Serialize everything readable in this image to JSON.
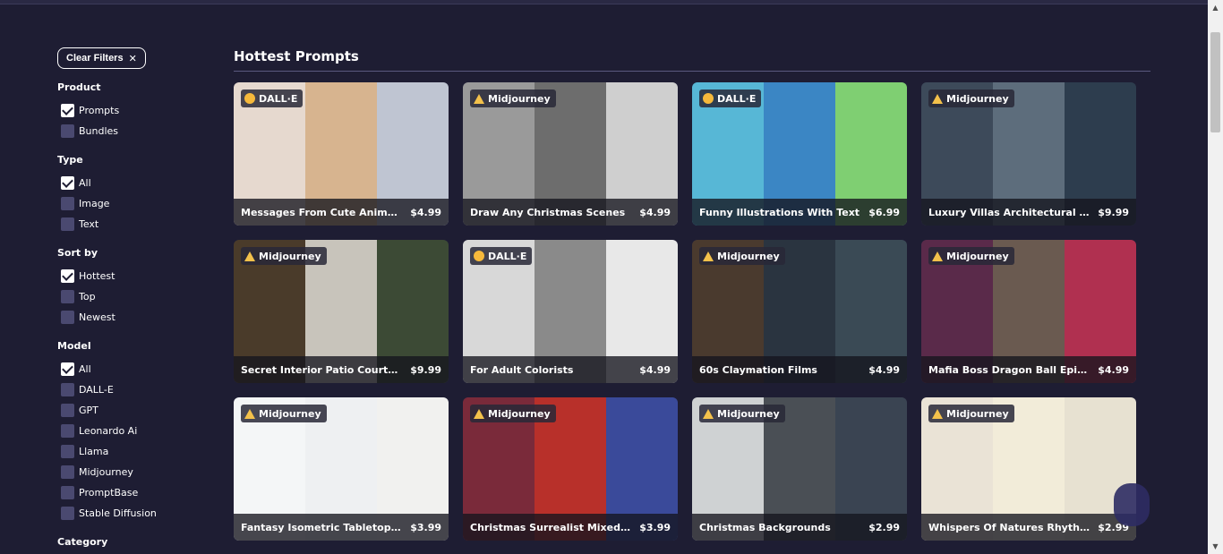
{
  "sidebar": {
    "clear_label": "Clear Filters",
    "groups": [
      {
        "title": "Product",
        "options": [
          {
            "label": "Prompts",
            "checked": true
          },
          {
            "label": "Bundles",
            "checked": false
          }
        ]
      },
      {
        "title": "Type",
        "options": [
          {
            "label": "All",
            "checked": true
          },
          {
            "label": "Image",
            "checked": false
          },
          {
            "label": "Text",
            "checked": false
          }
        ]
      },
      {
        "title": "Sort by",
        "options": [
          {
            "label": "Hottest",
            "checked": true
          },
          {
            "label": "Top",
            "checked": false
          },
          {
            "label": "Newest",
            "checked": false
          }
        ]
      },
      {
        "title": "Model",
        "options": [
          {
            "label": "All",
            "checked": true
          },
          {
            "label": "DALL-E",
            "checked": false
          },
          {
            "label": "GPT",
            "checked": false
          },
          {
            "label": "Leonardo Ai",
            "checked": false
          },
          {
            "label": "Llama",
            "checked": false
          },
          {
            "label": "Midjourney",
            "checked": false
          },
          {
            "label": "PromptBase",
            "checked": false
          },
          {
            "label": "Stable Diffusion",
            "checked": false
          }
        ]
      },
      {
        "title": "Category",
        "options": []
      }
    ]
  },
  "main": {
    "title": "Hottest Prompts",
    "cards": [
      {
        "model": "DALL·E",
        "icon": "dalle-icon",
        "title": "Messages From Cute Animals",
        "price": "$4.99",
        "colors": [
          "#e6d9cf",
          "#d7b48f",
          "#bfc5d2"
        ]
      },
      {
        "model": "Midjourney",
        "icon": "midjourney-icon",
        "title": "Draw Any Christmas Scenes",
        "price": "$4.99",
        "colors": [
          "#9a9a9a",
          "#6d6d6d",
          "#cfcfcf"
        ]
      },
      {
        "model": "DALL·E",
        "icon": "dalle-icon",
        "title": "Funny Illustrations With Text",
        "price": "$6.99",
        "colors": [
          "#57b7d6",
          "#3b86c4",
          "#7fcf72"
        ]
      },
      {
        "model": "Midjourney",
        "icon": "midjourney-icon",
        "title": "Luxury Villas Architectural Magnific...",
        "price": "$9.99",
        "colors": [
          "#3d4a5a",
          "#5d6d7c",
          "#2d3d4e"
        ]
      },
      {
        "model": "Midjourney",
        "icon": "midjourney-icon",
        "title": "Secret Interior Patio Courtyards",
        "price": "$9.99",
        "colors": [
          "#4a3b2a",
          "#c8c4bb",
          "#3c4a35"
        ]
      },
      {
        "model": "DALL·E",
        "icon": "dalle-icon",
        "title": "For Adult Colorists",
        "price": "$4.99",
        "colors": [
          "#d8d8d8",
          "#8a8a8a",
          "#e8e8e8"
        ]
      },
      {
        "model": "Midjourney",
        "icon": "midjourney-icon",
        "title": "60s Claymation Films",
        "price": "$4.99",
        "colors": [
          "#4a3a2e",
          "#2a3440",
          "#3a4a55"
        ]
      },
      {
        "model": "Midjourney",
        "icon": "midjourney-icon",
        "title": "Mafia Boss Dragon Ball Epic Fusions",
        "price": "$4.99",
        "colors": [
          "#5a2a4a",
          "#6a5a50",
          "#b03050"
        ]
      },
      {
        "model": "Midjourney",
        "icon": "midjourney-icon",
        "title": "Fantasy Isometric Tabletop Map Ass...",
        "price": "$3.99",
        "colors": [
          "#f4f6f7",
          "#eef0f2",
          "#f1f1ef"
        ]
      },
      {
        "model": "Midjourney",
        "icon": "midjourney-icon",
        "title": "Christmas Surrealist Mixed Media C...",
        "price": "$3.99",
        "colors": [
          "#7a2a3a",
          "#b8302a",
          "#3a4a9a"
        ]
      },
      {
        "model": "Midjourney",
        "icon": "midjourney-icon",
        "title": "Christmas Backgrounds",
        "price": "$2.99",
        "colors": [
          "#cfd2d3",
          "#4a4f55",
          "#3a4452"
        ]
      },
      {
        "model": "Midjourney",
        "icon": "midjourney-icon",
        "title": "Whispers Of Natures Rhythms",
        "price": "$2.99",
        "colors": [
          "#eae3d6",
          "#f2ecd9",
          "#e7e1d1"
        ]
      }
    ]
  }
}
